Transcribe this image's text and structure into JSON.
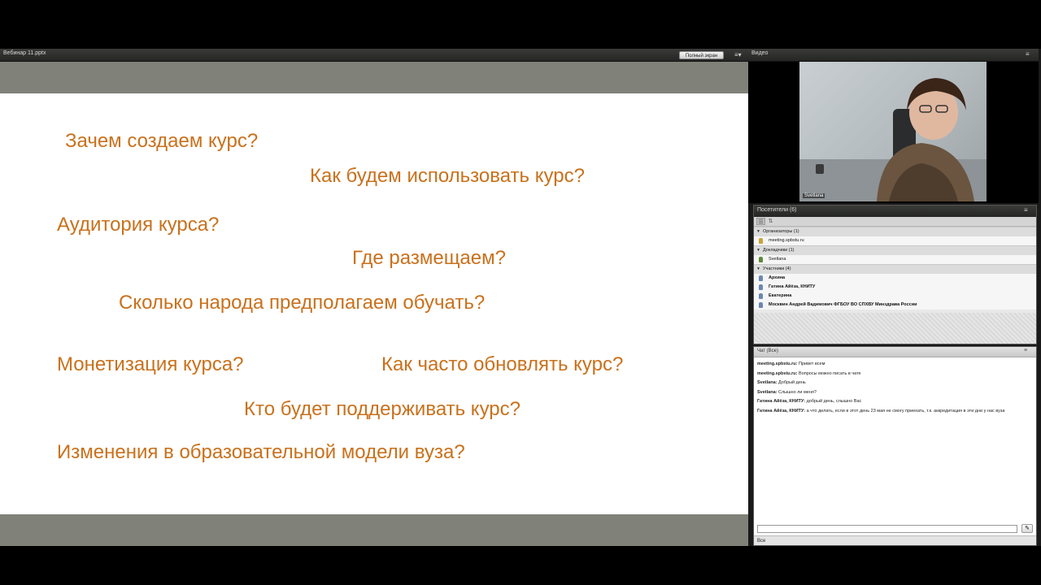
{
  "presentation": {
    "file_name": "Вебинар 11.pptx",
    "fullscreen_label": "Полный экран",
    "menu_icon": "menu-icon"
  },
  "slide": {
    "text_color": "#c9711c",
    "lines": [
      "Зачем создаем курс?",
      "Как будем использовать курс?",
      "Аудитория курса?",
      "Где размещаем?",
      "Сколько народа предполагаем обучать?",
      "Монетизация курса?",
      "Как часто обновлять курс?",
      "Кто будет поддерживать курс?",
      "Изменения в образовательной модели вуза?"
    ]
  },
  "video": {
    "title": "Видео",
    "speaker_label": "Svetlana"
  },
  "attendees": {
    "title": "Посетители",
    "count": "(6)",
    "groups": [
      {
        "label": "Организаторы (1)",
        "members": [
          "meeting.spbstu.ru"
        ]
      },
      {
        "label": "Докладчики (1)",
        "members": [
          "Svetlana"
        ]
      },
      {
        "label": "Участники (4)",
        "members": [
          "Архина",
          "Гатина Айёза, КНИТУ",
          "Екатерина",
          "Москвин Андрей Вадимович ФГБОУ ВО СПХВУ Минздрава России"
        ]
      }
    ]
  },
  "chat": {
    "title": "Чат",
    "count": "(Все)",
    "messages": [
      {
        "sender": "meeting.spbstu.ru:",
        "text": "Привет всем"
      },
      {
        "sender": "meeting.spbstu.ru:",
        "text": "Вопросы можно писать в чате"
      },
      {
        "sender": "Svetlana:",
        "text": "Добрый день"
      },
      {
        "sender": "Svetlana:",
        "text": "Слышно ли меня?"
      },
      {
        "sender": "Гатина Айёза, КНИТУ:",
        "text": "добрый день, слышно Вас"
      },
      {
        "sender": "Гатина Айёза, КНИТУ:",
        "text": "а что делать, если в этот день 23 мая не смогу приехать, т.к. аккредитация в эти дни у нас вуза"
      }
    ],
    "input_value": "",
    "target_label": "Все"
  }
}
